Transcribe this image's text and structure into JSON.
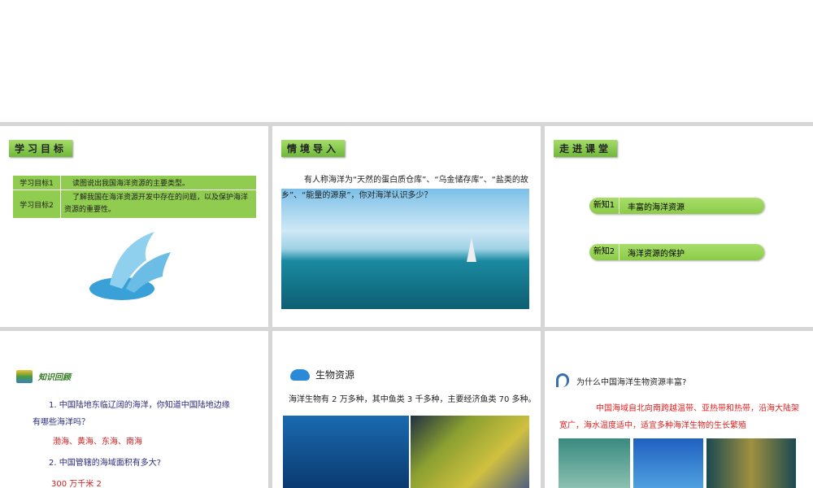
{
  "slide1": {
    "tag": "学习目标",
    "rows": [
      {
        "h": "学习目标1",
        "t": "读图说出我国海洋资源的主要类型。"
      },
      {
        "h": "学习目标2",
        "t": "了解我国在海洋资源开发中存在的问题，以及保护海洋资源的重要性。"
      }
    ]
  },
  "slide2": {
    "tag": "情境导入",
    "text": "有人称海洋为“天然的蛋白质仓库”、“乌金储存库”、“盐类的故乡”、“能量的源泉”，你对海洋认识多少？"
  },
  "slide3": {
    "tag": "走进课堂",
    "items": [
      {
        "n": "新知1",
        "l": "丰富的海洋资源"
      },
      {
        "n": "新知2",
        "l": "海洋资源的保护"
      }
    ]
  },
  "slide4": {
    "title": "知识回顾",
    "q1": "1. 中国陆地东临辽阔的海洋，你知道中国陆地边缘有哪些海洋吗？",
    "a1": "渤海、黄海、东海、南海",
    "q2": "2.   中国管辖的海域面积有多大?",
    "a2": "300 万千米 2"
  },
  "slide5": {
    "title": "生物资源",
    "text": "海洋生物有 2 万多种，其中鱼类 3 千多种，主要经济鱼类 70 多种。"
  },
  "slide6": {
    "question": "为什么中国海洋生物资源丰富?",
    "answer": "中国海域自北向南跨越温带、亚热带和热带，沿海大陆架宽广，海水温度适中，适宜多种海洋生物的生长繁殖"
  }
}
